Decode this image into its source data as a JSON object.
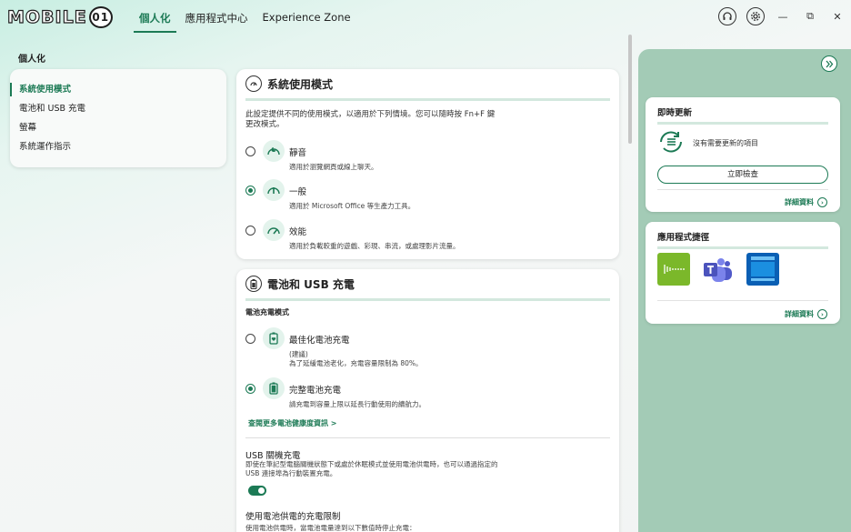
{
  "titlebar": {
    "logo_text": "MOBILE",
    "logo_badge": "01",
    "tabs": [
      {
        "label": "個人化",
        "active": true
      },
      {
        "label": "應用程式中心",
        "active": false
      },
      {
        "label": "Experience Zone",
        "active": false
      }
    ],
    "icons": [
      "headset-icon",
      "gear-icon"
    ],
    "window_controls": {
      "minimize": "—",
      "restore": "⧉",
      "close": "✕"
    }
  },
  "sidebar": {
    "title": "個人化",
    "items": [
      {
        "label": "系統使用模式",
        "active": true
      },
      {
        "label": "電池和 USB 充電",
        "active": false
      },
      {
        "label": "螢幕",
        "active": false
      },
      {
        "label": "系統運作指示",
        "active": false
      }
    ]
  },
  "mode_card": {
    "title": "系統使用模式",
    "description": "此設定提供不同的使用模式，以適用於下列情境。您可以隨時按 Fn+F 鍵更改模式。",
    "options": [
      {
        "title": "靜音",
        "subtitle": "適用於瀏覽網頁或線上聊天。",
        "selected": false,
        "icon": "moon-gauge-icon"
      },
      {
        "title": "一般",
        "subtitle": "適用於 Microsoft Office 等生產力工具。",
        "selected": true,
        "icon": "gauge-mid-icon"
      },
      {
        "title": "效能",
        "subtitle": "適用於負載較重的遊戲、彩現、串流，或處理影片流量。",
        "selected": false,
        "icon": "gauge-high-icon"
      }
    ]
  },
  "battery_card": {
    "title": "電池和 USB 充電",
    "charge_mode_label": "電池充電模式",
    "options": [
      {
        "title": "最佳化電池充電",
        "subtitle_line1": "(建議)",
        "subtitle_line2": "為了延緩電池老化，充電容量限制為 80%。",
        "selected": false
      },
      {
        "title": "完整電池充電",
        "subtitle_line1": "請充電到容量上限以延長行動使用的續航力。",
        "subtitle_line2": "",
        "selected": true
      }
    ],
    "more_link": "查閱更多電池健康度資訊 >",
    "usb": {
      "title": "USB 關機充電",
      "description": "即使在筆記型電腦關機狀態下或處於休眠模式並使用電池供電時，也可以通過指定的 USB 連接埠為行動裝置充電。",
      "enabled": true
    },
    "limit": {
      "title": "使用電池供電的充電限制",
      "description": "使用電池供電時，當電池電量達到以下數值時停止充電："
    }
  },
  "right_panel": {
    "update_card": {
      "title": "即時更新",
      "status": "沒有需要更新的項目",
      "button": "立即檢查",
      "details": "詳細資料"
    },
    "apps_card": {
      "title": "應用程式捷徑",
      "apps": [
        {
          "name": "audio-app-icon",
          "color": "#7bb82a"
        },
        {
          "name": "teams-icon",
          "color": "#5b5fc7"
        },
        {
          "name": "window-app-icon",
          "color": "#0a5fb4"
        }
      ],
      "details": "詳細資料"
    }
  }
}
